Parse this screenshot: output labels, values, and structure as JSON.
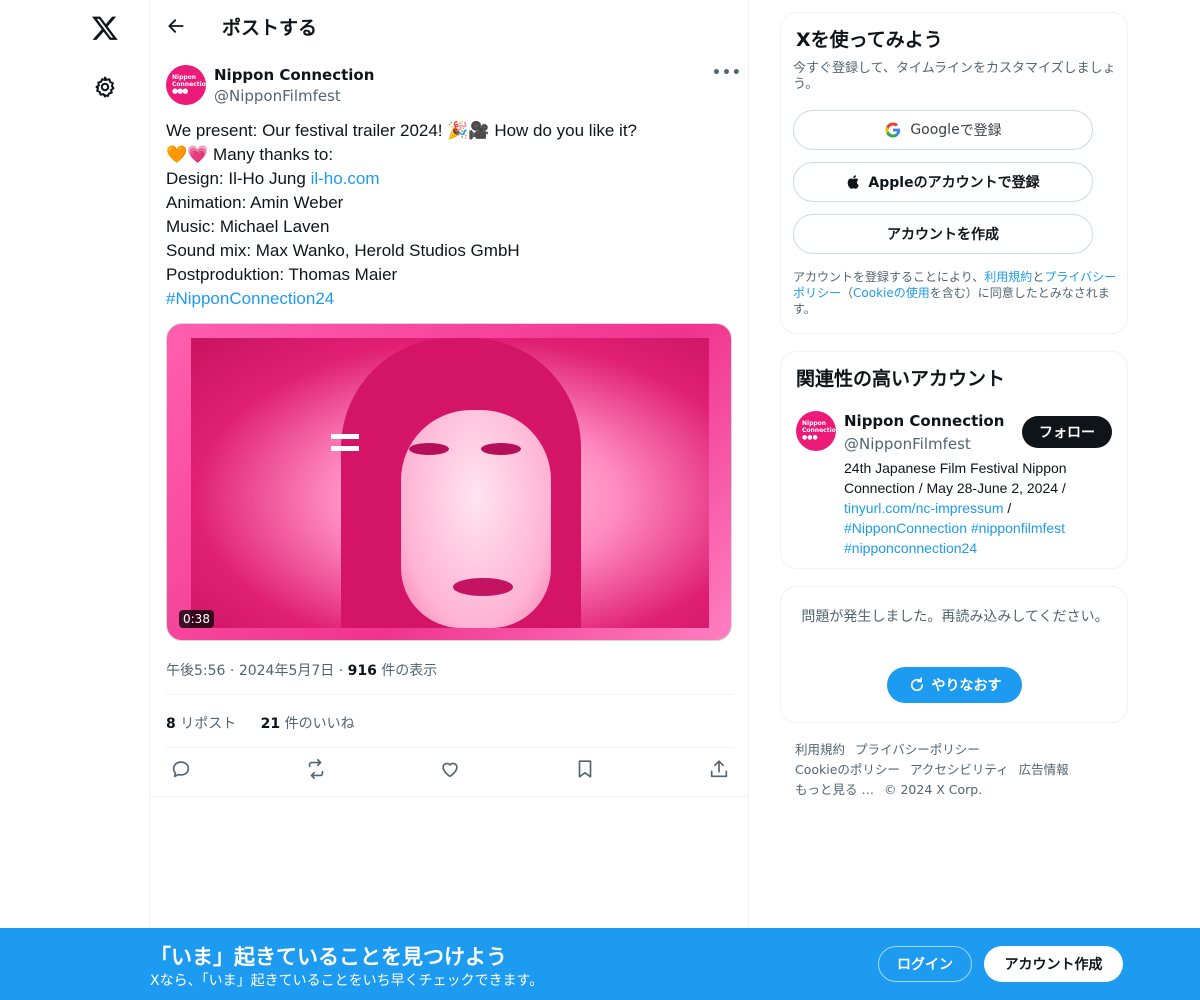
{
  "header": {
    "title": "ポストする"
  },
  "post": {
    "author_name": "Nippon Connection",
    "author_handle": "@NipponFilmfest",
    "avatar_text": "Nippon Connection",
    "text": {
      "line1": "We present: Our festival trailer 2024! 🎉🎥 How do you like it?",
      "line2": "🧡💗 Many thanks to:",
      "line3_prefix": "Design: Il-Ho Jung ",
      "line3_link": "il-ho.com",
      "line4": "Animation: Amin Weber",
      "line5": "Music: Michael Laven",
      "line6": "Sound mix: Max Wanko, Herold Studios GmbH",
      "line7": "Postproduktion: Thomas Maier",
      "hashtag": "#NipponConnection24"
    },
    "video_duration": "0:38",
    "time": "午後5:56",
    "date": "2024年5月7日",
    "views_count": "916",
    "views_label": "件の表示",
    "reposts_count": "8",
    "reposts_label": "リポスト",
    "likes_count": "21",
    "likes_label": "件のいいね"
  },
  "signup_card": {
    "title": "Xを使ってみよう",
    "subtitle": "今すぐ登録して、タイムラインをカスタマイズしましょう。",
    "google_brand": "Google",
    "google_suffix": " で登録",
    "apple_label": "Appleのアカウントで登録",
    "create_label": "アカウントを作成",
    "terms_1": "アカウントを登録することにより、",
    "terms_link1": "利用規約",
    "terms_2": "と",
    "terms_link2": "プライバシーポリシー",
    "terms_3": "（",
    "terms_link3": "Cookieの使用",
    "terms_4": "を含む）に同意したとみなされます。"
  },
  "related_card": {
    "title": "関連性の高いアカウント",
    "name": "Nippon Connection",
    "handle": "@NipponFilmfest",
    "follow_label": "フォロー",
    "bio_text": "24th Japanese Film Festival Nippon Connection / May 28-June 2, 2024 /",
    "bio_link": "tinyurl.com/nc-impressum",
    "bio_slash": " /",
    "bio_tag1": "#NipponConnection",
    "bio_tag2": "#nipponfilmfest",
    "bio_tag3": "#nipponconnection24"
  },
  "error_card": {
    "message": "問題が発生しました。再読み込みしてください。",
    "retry_label": "やりなおす"
  },
  "footer": {
    "terms": "利用規約",
    "privacy": "プライバシーポリシー",
    "cookie": "Cookieのポリシー",
    "accessibility": "アクセシビリティ",
    "ads": "広告情報",
    "more": "もっと見る …",
    "copyright": "© 2024 X Corp."
  },
  "banner": {
    "title": "「いま」起きていることを見つけよう",
    "subtitle": "Xなら、「いま」起きていることをいち早くチェックできます。",
    "login_label": "ログイン",
    "signup_label": "アカウント作成"
  },
  "colors": {
    "accent": "#1d9bf0",
    "brand_pink": "#ec1a78",
    "text_primary": "#0f1419",
    "text_secondary": "#536471"
  },
  "icons": [
    "x-logo-icon",
    "gear-icon",
    "back-arrow-icon",
    "more-icon",
    "reply-icon",
    "repost-icon",
    "like-icon",
    "bookmark-icon",
    "share-icon",
    "google-icon",
    "apple-icon",
    "refresh-icon"
  ]
}
